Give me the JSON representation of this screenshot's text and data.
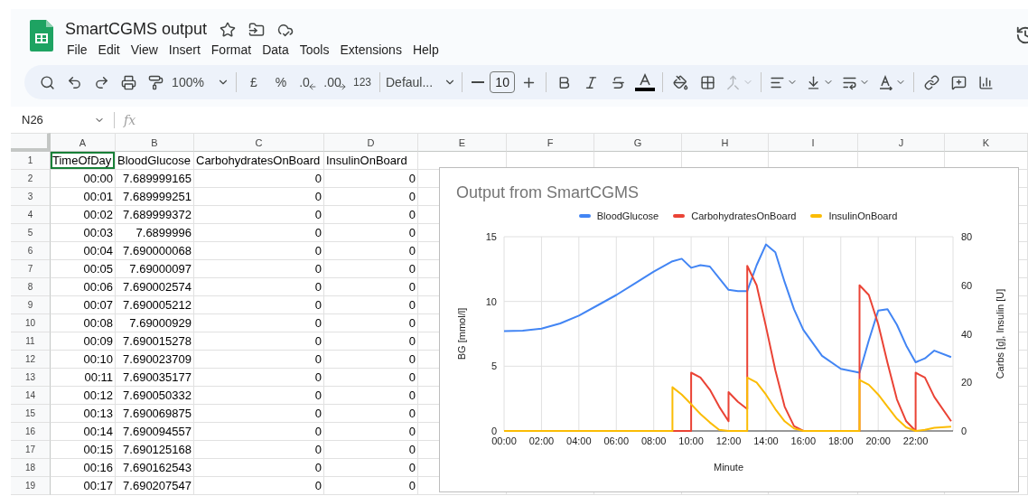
{
  "document": {
    "title": "SmartCGMS output"
  },
  "menu": [
    "File",
    "Edit",
    "View",
    "Insert",
    "Format",
    "Data",
    "Tools",
    "Extensions",
    "Help"
  ],
  "toolbar": {
    "zoom": "100%",
    "currency": "£",
    "percent": "%",
    "decrease_decimal": ".0",
    "increase_decimal": ".00",
    "number_format": "123",
    "font": "Defaul...",
    "font_size": "10",
    "merge_cells": {
      "disabled": true
    }
  },
  "formula_bar": {
    "cell": "N26",
    "label": "fx"
  },
  "sheet": {
    "columns": [
      "A",
      "B",
      "C",
      "D",
      "E",
      "F",
      "G",
      "H",
      "I",
      "J",
      "K"
    ],
    "rows": [
      {
        "number": "1",
        "kind": "header",
        "cells": [
          {
            "text": "TimeOfDay",
            "selected": true
          },
          {
            "text": "BloodGlucose",
            "selected": false
          },
          {
            "text": "CarbohydratesOnBoard",
            "selected": false
          },
          {
            "text": "InsulinOnBoard",
            "selected": false
          }
        ]
      },
      {
        "number": "2",
        "kind": "data",
        "cells": [
          {
            "text": "00:00",
            "selected": false
          },
          {
            "text": "7.689999165",
            "selected": false
          },
          {
            "text": "0",
            "selected": false
          },
          {
            "text": "0",
            "selected": false
          }
        ]
      },
      {
        "number": "3",
        "kind": "data",
        "cells": [
          {
            "text": "00:01",
            "selected": false
          },
          {
            "text": "7.689999251",
            "selected": false
          },
          {
            "text": "0",
            "selected": false
          },
          {
            "text": "0",
            "selected": false
          }
        ]
      },
      {
        "number": "4",
        "kind": "data",
        "cells": [
          {
            "text": "00:02",
            "selected": false
          },
          {
            "text": "7.689999372",
            "selected": false
          },
          {
            "text": "0",
            "selected": false
          },
          {
            "text": "0",
            "selected": false
          }
        ]
      },
      {
        "number": "5",
        "kind": "data",
        "cells": [
          {
            "text": "00:03",
            "selected": false
          },
          {
            "text": "7.6899996",
            "selected": false
          },
          {
            "text": "0",
            "selected": false
          },
          {
            "text": "0",
            "selected": false
          }
        ]
      },
      {
        "number": "6",
        "kind": "data",
        "cells": [
          {
            "text": "00:04",
            "selected": false
          },
          {
            "text": "7.690000068",
            "selected": false
          },
          {
            "text": "0",
            "selected": false
          },
          {
            "text": "0",
            "selected": false
          }
        ]
      },
      {
        "number": "7",
        "kind": "data",
        "cells": [
          {
            "text": "00:05",
            "selected": false
          },
          {
            "text": "7.69000097",
            "selected": false
          },
          {
            "text": "0",
            "selected": false
          },
          {
            "text": "0",
            "selected": false
          }
        ]
      },
      {
        "number": "8",
        "kind": "data",
        "cells": [
          {
            "text": "00:06",
            "selected": false
          },
          {
            "text": "7.690002574",
            "selected": false
          },
          {
            "text": "0",
            "selected": false
          },
          {
            "text": "0",
            "selected": false
          }
        ]
      },
      {
        "number": "9",
        "kind": "data",
        "cells": [
          {
            "text": "00:07",
            "selected": false
          },
          {
            "text": "7.690005212",
            "selected": false
          },
          {
            "text": "0",
            "selected": false
          },
          {
            "text": "0",
            "selected": false
          }
        ]
      },
      {
        "number": "10",
        "kind": "data",
        "cells": [
          {
            "text": "00:08",
            "selected": false
          },
          {
            "text": "7.69000929",
            "selected": false
          },
          {
            "text": "0",
            "selected": false
          },
          {
            "text": "0",
            "selected": false
          }
        ]
      },
      {
        "number": "11",
        "kind": "data",
        "cells": [
          {
            "text": "00:09",
            "selected": false
          },
          {
            "text": "7.690015278",
            "selected": false
          },
          {
            "text": "0",
            "selected": false
          },
          {
            "text": "0",
            "selected": false
          }
        ]
      },
      {
        "number": "12",
        "kind": "data",
        "cells": [
          {
            "text": "00:10",
            "selected": false
          },
          {
            "text": "7.690023709",
            "selected": false
          },
          {
            "text": "0",
            "selected": false
          },
          {
            "text": "0",
            "selected": false
          }
        ]
      },
      {
        "number": "13",
        "kind": "data",
        "cells": [
          {
            "text": "00:11",
            "selected": false
          },
          {
            "text": "7.690035177",
            "selected": false
          },
          {
            "text": "0",
            "selected": false
          },
          {
            "text": "0",
            "selected": false
          }
        ]
      },
      {
        "number": "14",
        "kind": "data",
        "cells": [
          {
            "text": "00:12",
            "selected": false
          },
          {
            "text": "7.690050332",
            "selected": false
          },
          {
            "text": "0",
            "selected": false
          },
          {
            "text": "0",
            "selected": false
          }
        ]
      },
      {
        "number": "15",
        "kind": "data",
        "cells": [
          {
            "text": "00:13",
            "selected": false
          },
          {
            "text": "7.690069875",
            "selected": false
          },
          {
            "text": "0",
            "selected": false
          },
          {
            "text": "0",
            "selected": false
          }
        ]
      },
      {
        "number": "16",
        "kind": "data",
        "cells": [
          {
            "text": "00:14",
            "selected": false
          },
          {
            "text": "7.690094557",
            "selected": false
          },
          {
            "text": "0",
            "selected": false
          },
          {
            "text": "0",
            "selected": false
          }
        ]
      },
      {
        "number": "17",
        "kind": "data",
        "cells": [
          {
            "text": "00:15",
            "selected": false
          },
          {
            "text": "7.690125168",
            "selected": false
          },
          {
            "text": "0",
            "selected": false
          },
          {
            "text": "0",
            "selected": false
          }
        ]
      },
      {
        "number": "18",
        "kind": "data",
        "cells": [
          {
            "text": "00:16",
            "selected": false
          },
          {
            "text": "7.690162543",
            "selected": false
          },
          {
            "text": "0",
            "selected": false
          },
          {
            "text": "0",
            "selected": false
          }
        ]
      },
      {
        "number": "19",
        "kind": "data",
        "cells": [
          {
            "text": "00:17",
            "selected": false
          },
          {
            "text": "7.690207547",
            "selected": false
          },
          {
            "text": "0",
            "selected": false
          },
          {
            "text": "0",
            "selected": false
          }
        ]
      }
    ]
  },
  "chart": {
    "chart_data": {
      "type": "line",
      "title": "Output from SmartCGMS",
      "xlabel": "Minute",
      "ylabel": "BG [mmol/l]",
      "y2label": "Carbs [g], Insulin [U]",
      "x": [
        0,
        1,
        2,
        3,
        4,
        5,
        6,
        7,
        8,
        9,
        9,
        9.5,
        10,
        10,
        10.5,
        11,
        11.5,
        12,
        12,
        12.5,
        13,
        13,
        13.5,
        14,
        14.5,
        15,
        15.5,
        16,
        17,
        18,
        19,
        19,
        19.5,
        20,
        20.5,
        21,
        21.5,
        22,
        22,
        22.5,
        23,
        23.9
      ],
      "xlim": [
        0,
        24
      ],
      "ylim": [
        0,
        15
      ],
      "y2lim": [
        0,
        80
      ],
      "xticks": [
        {
          "value": 0,
          "label": "00:00"
        },
        {
          "value": 2,
          "label": "02:00"
        },
        {
          "value": 4,
          "label": "04:00"
        },
        {
          "value": 6,
          "label": "06:00"
        },
        {
          "value": 8,
          "label": "08:00"
        },
        {
          "value": 10,
          "label": "10:00"
        },
        {
          "value": 12,
          "label": "12:00"
        },
        {
          "value": 14,
          "label": "14:00"
        },
        {
          "value": 16,
          "label": "16:00"
        },
        {
          "value": 18,
          "label": "18:00"
        },
        {
          "value": 20,
          "label": "20:00"
        },
        {
          "value": 22,
          "label": "22:00"
        }
      ],
      "yticks": [
        0,
        5,
        10,
        15
      ],
      "grid": true,
      "y2ticks": [
        0,
        20,
        40,
        60,
        80
      ],
      "series": [
        {
          "name": "BloodGlucose",
          "color": "#4285f4",
          "axis": "y",
          "values": [
            7.7,
            7.75,
            7.9,
            8.3,
            8.9,
            9.7,
            10.5,
            11.4,
            12.3,
            13.1,
            13.1,
            13.3,
            12.6,
            12.6,
            12.8,
            12.7,
            11.8,
            10.9,
            10.9,
            10.8,
            10.8,
            10.8,
            12.8,
            14.4,
            13.8,
            11.5,
            9.4,
            7.8,
            5.8,
            4.8,
            4.5,
            4.5,
            7.0,
            9.3,
            9.4,
            8.2,
            6.6,
            5.3,
            5.3,
            5.6,
            6.2,
            5.7
          ]
        },
        {
          "name": "CarbohydratesOnBoard",
          "color": "#ea4335",
          "axis": "y2",
          "values": [
            null,
            null,
            null,
            null,
            null,
            null,
            null,
            null,
            0,
            0,
            0,
            0,
            0,
            24,
            22,
            17,
            10,
            4,
            16,
            12,
            9,
            68,
            60,
            43,
            25,
            10,
            2,
            0,
            0,
            0,
            0,
            60,
            56,
            44,
            28,
            13,
            4,
            0,
            24,
            22,
            14,
            4
          ]
        },
        {
          "name": "InsulinOnBoard",
          "color": "#fbbc04",
          "axis": "y2",
          "values": [
            0,
            0,
            0,
            0,
            0,
            0,
            0,
            0,
            0,
            0,
            18,
            15,
            11,
            11,
            7,
            3.5,
            0.5,
            0,
            0,
            0,
            0,
            22,
            20,
            15,
            9,
            4,
            1,
            0,
            0,
            0,
            0,
            21,
            19,
            15,
            10,
            5,
            1.5,
            0,
            0,
            0.5,
            1.3,
            1.8
          ]
        }
      ]
    }
  }
}
